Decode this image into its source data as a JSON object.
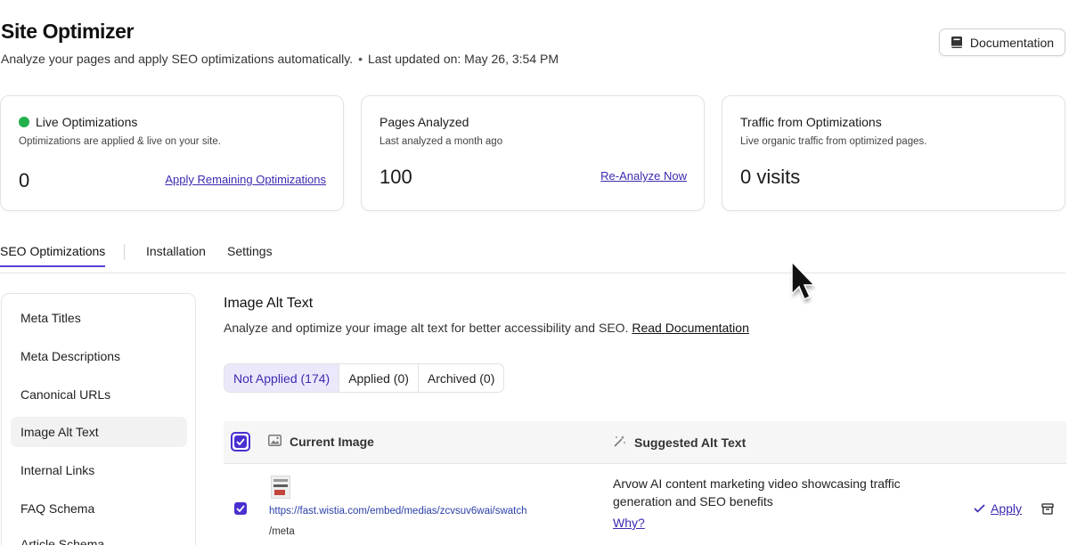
{
  "header": {
    "title": "Site Optimizer",
    "subtitle": "Analyze your pages and apply SEO optimizations automatically.",
    "separator": "•",
    "last_updated": "Last updated on: May 26, 3:54 PM",
    "documentation_label": "Documentation"
  },
  "cards": {
    "live": {
      "title": "Live Optimizations",
      "desc": "Optimizations are applied & live on your site.",
      "value": "0",
      "link": "Apply Remaining Optimizations",
      "status_color": "#22b14c"
    },
    "pages": {
      "title": "Pages Analyzed",
      "desc": "Last analyzed a month ago",
      "value": "100",
      "link": "Re-Analyze Now"
    },
    "traffic": {
      "title": "Traffic from Optimizations",
      "desc": "Live organic traffic from optimized pages.",
      "value": "0 visits"
    }
  },
  "tabs": {
    "seo": "SEO Optimizations",
    "installation": "Installation",
    "settings": "Settings"
  },
  "sidebar": {
    "items": [
      {
        "label": "Meta Titles"
      },
      {
        "label": "Meta Descriptions"
      },
      {
        "label": "Canonical URLs"
      },
      {
        "label": "Image Alt Text"
      },
      {
        "label": "Internal Links"
      },
      {
        "label": "FAQ Schema"
      },
      {
        "label": "Article Schema"
      }
    ],
    "active": "Image Alt Text"
  },
  "main": {
    "title": "Image Alt Text",
    "desc": "Analyze and optimize your image alt text for better accessibility and SEO.",
    "doc_link": "Read Documentation",
    "filters": {
      "not_applied": "Not Applied (174)",
      "applied": "Applied (0)",
      "archived": "Archived (0)"
    },
    "table": {
      "col_image": "Current Image",
      "col_alt": "Suggested Alt Text",
      "rows": [
        {
          "url": "https://fast.wistia.com/embed/medias/zcvsuv6wai/swatch",
          "path": "/meta",
          "alt": "Arvow AI content marketing video showcasing traffic generation and SEO benefits",
          "why": "Why?",
          "apply": "Apply"
        }
      ]
    }
  },
  "colors": {
    "accent": "#4a2fd0",
    "link": "#3b2bb0",
    "live": "#22b14c"
  }
}
